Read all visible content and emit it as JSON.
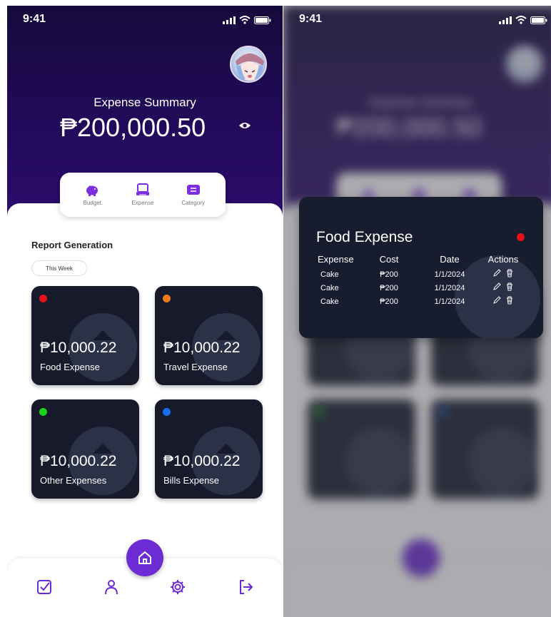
{
  "status": {
    "time": "9:41"
  },
  "summary": {
    "title": "Expense Summary",
    "amount": "₱200,000.50"
  },
  "menu": {
    "items": [
      {
        "label": "Budget",
        "icon": "piggy-bank-icon"
      },
      {
        "label": "Expense",
        "icon": "printer-icon"
      },
      {
        "label": "Category",
        "icon": "list-icon"
      }
    ]
  },
  "report": {
    "title": "Report Generation",
    "filter": "This Week"
  },
  "cards": [
    {
      "amount": "₱10,000.22",
      "name": "Food Expense",
      "dot_color": "#e5121c"
    },
    {
      "amount": "₱10,000.22",
      "name": "Travel Expense",
      "dot_color": "#f07a1a"
    },
    {
      "amount": "₱10,000.22",
      "name": "Other Expenses",
      "dot_color": "#1ad41a"
    },
    {
      "amount": "₱10,000.22",
      "name": "Bills Expense",
      "dot_color": "#1a6ef0"
    }
  ],
  "nav": {
    "items": [
      "checkbox-icon",
      "user-icon",
      "home-icon",
      "settings-icon",
      "logout-icon"
    ]
  },
  "modal": {
    "title": "Food Expense",
    "dot_color": "#e5121c",
    "headers": [
      "Expense",
      "Cost",
      "Date",
      "Actions"
    ],
    "rows": [
      {
        "expense": "Cake",
        "cost": "₱200",
        "date": "1/1/2024"
      },
      {
        "expense": "Cake",
        "cost": "₱200",
        "date": "1/1/2024"
      },
      {
        "expense": "Cake",
        "cost": "₱200",
        "date": "1/1/2024"
      }
    ]
  },
  "colors": {
    "accent": "#6c2bd3",
    "hero_dark": "#150a3b",
    "card_bg": "#161a2b"
  }
}
